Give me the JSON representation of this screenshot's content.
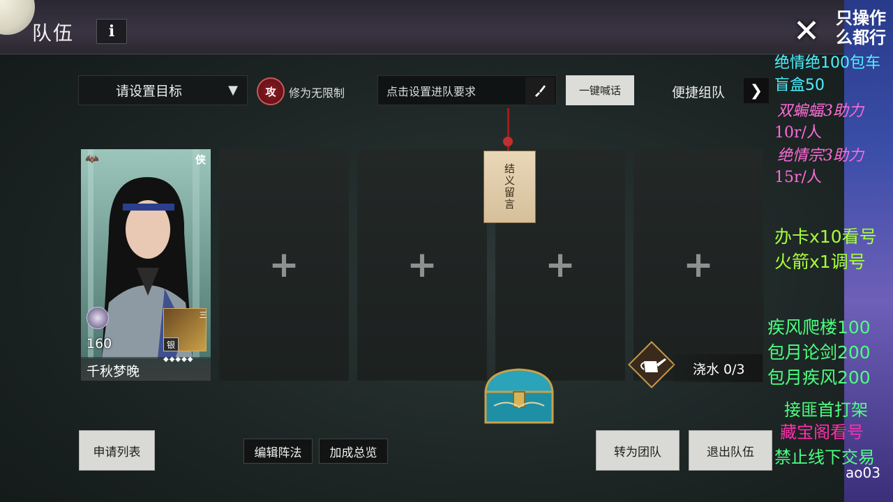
{
  "header": {
    "title": "队伍",
    "info_label": "i",
    "close_label": "✕"
  },
  "controls": {
    "target_label": "请设置目标",
    "target_chevron": "▼",
    "gong_label": "攻",
    "cultivation_limit": "修为无限制",
    "requirement_placeholder": "点击设置进队要求",
    "shout_label": "一键喊话",
    "quick_team_label": "便捷组队",
    "quick_team_arrow": "❯"
  },
  "member": {
    "role_tag": "侠",
    "level": "160",
    "weapon_tier": "三",
    "silver_tag": "银",
    "stars": "◆◆◆◆◆",
    "name": "千秋梦晚"
  },
  "slots": {
    "plus": "+"
  },
  "message_tag": {
    "text": "结义留言"
  },
  "watering": {
    "label": "浇水 0/3"
  },
  "buttons": {
    "apply_list": "申请列表",
    "edit_formation": "编辑阵法",
    "bonus_overview": "加成总览",
    "to_raid": "转为团队",
    "leave_team": "退出队伍"
  },
  "stream_overlay": {
    "top_line1": "只操作",
    "top_line2": "么都行",
    "lines": [
      "绝情绝100包车",
      "盲盒50",
      "双蝙蝠3助力",
      "10r/人",
      "绝情宗3助力",
      "15r/人",
      "办卡x10看号",
      "火箭x1调号",
      "疾风爬楼100",
      "包月论剑200",
      "包月疾风200",
      "接匪首打架",
      "藏宝阁看号",
      "禁止线下交易",
      "ao03"
    ]
  },
  "colors": {
    "overlay_cyan": "#4cf0ff",
    "overlay_pink": "#ff6cd9",
    "overlay_green": "#4dff80",
    "overlay_lime": "#a8ff3a",
    "overlay_magenta": "#ff2fae"
  }
}
